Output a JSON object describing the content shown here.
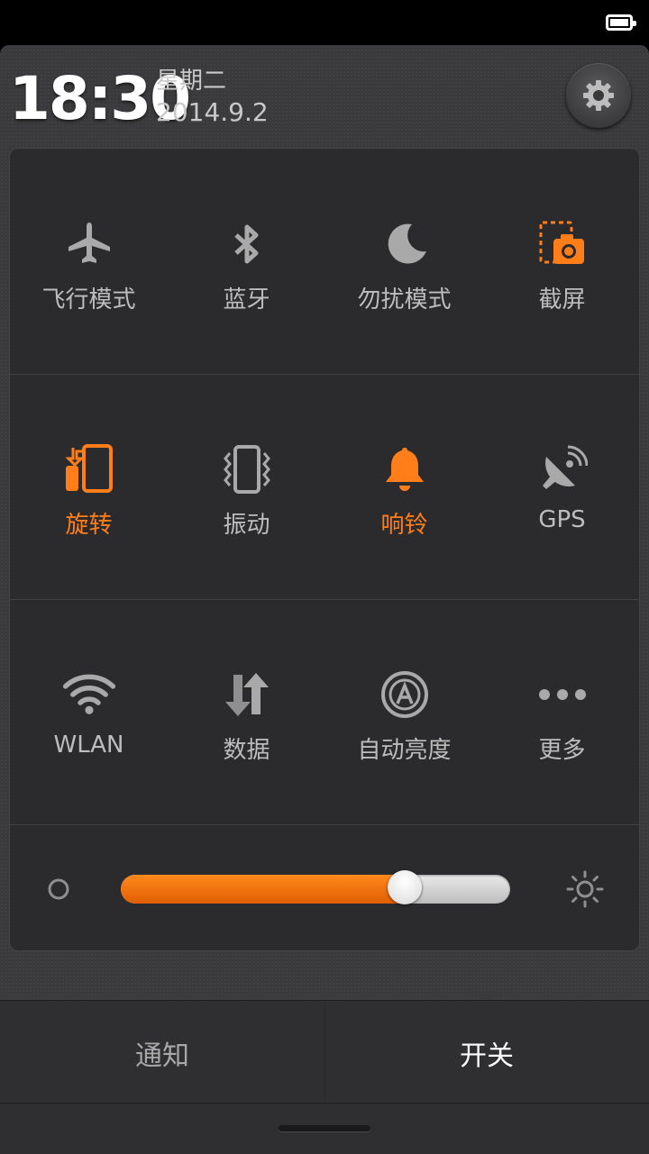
{
  "status_bar": {
    "battery_icon": "battery-full-icon"
  },
  "header": {
    "time": "18:30",
    "weekday": "星期二",
    "date": "2014.9.2",
    "settings_icon": "gear-icon"
  },
  "toggles": [
    {
      "id": "airplane",
      "label": "飞行模式",
      "icon": "airplane-icon",
      "active": false
    },
    {
      "id": "bluetooth",
      "label": "蓝牙",
      "icon": "bluetooth-icon",
      "active": false
    },
    {
      "id": "dnd",
      "label": "勿扰模式",
      "icon": "moon-icon",
      "active": false
    },
    {
      "id": "screenshot",
      "label": "截屏",
      "icon": "screenshot-camera-icon",
      "active": true
    },
    {
      "id": "rotation",
      "label": "旋转",
      "icon": "rotate-phone-icon",
      "active": true
    },
    {
      "id": "vibrate",
      "label": "振动",
      "icon": "vibrate-phone-icon",
      "active": false
    },
    {
      "id": "ringer",
      "label": "响铃",
      "icon": "bell-icon",
      "active": true
    },
    {
      "id": "gps",
      "label": "GPS",
      "icon": "gps-satellite-icon",
      "active": false
    },
    {
      "id": "wlan",
      "label": "WLAN",
      "icon": "wifi-icon",
      "active": false
    },
    {
      "id": "data",
      "label": "数据",
      "icon": "data-arrows-icon",
      "active": false
    },
    {
      "id": "auto_brightness",
      "label": "自动亮度",
      "icon": "auto-brightness-icon",
      "active": false
    },
    {
      "id": "more",
      "label": "更多",
      "icon": "more-dots-icon",
      "active": false
    }
  ],
  "brightness": {
    "level": 0.73,
    "low_icon": "brightness-low-icon",
    "high_icon": "brightness-high-icon"
  },
  "tabs": {
    "notifications": "通知",
    "toggles": "开关",
    "selected": "toggles"
  },
  "colors": {
    "accent": "#ff7e1a",
    "inactive_icon": "#a9a9a9",
    "panel": "#2b2b2d"
  }
}
